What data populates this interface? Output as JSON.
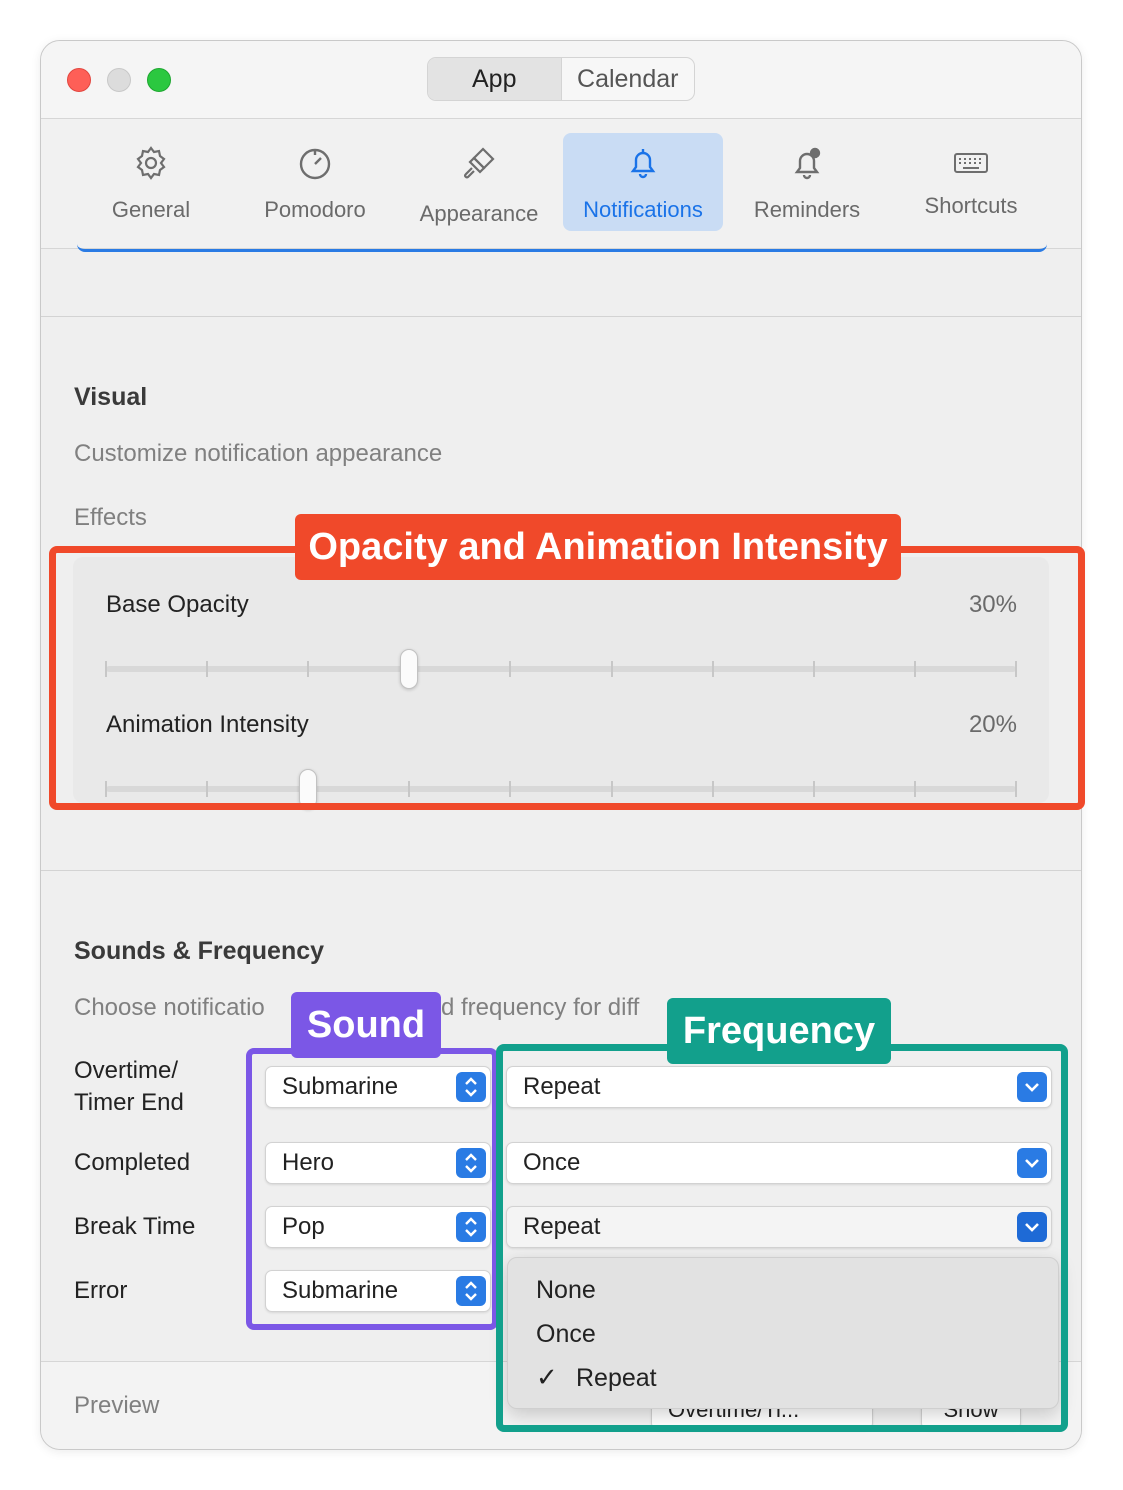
{
  "window": {
    "tabs": [
      {
        "label": "App",
        "active": true
      },
      {
        "label": "Calendar",
        "active": false
      }
    ]
  },
  "toolbar": {
    "items": [
      {
        "label": "General",
        "icon": "gear-icon"
      },
      {
        "label": "Pomodoro",
        "icon": "timer-icon"
      },
      {
        "label": "Appearance",
        "icon": "paintbrush-icon"
      },
      {
        "label": "Notifications",
        "icon": "bell-icon",
        "active": true
      },
      {
        "label": "Reminders",
        "icon": "bell-badge-icon"
      },
      {
        "label": "Shortcuts",
        "icon": "keyboard-icon"
      }
    ]
  },
  "visual": {
    "title": "Visual",
    "subtitle": "Customize notification appearance",
    "effects_label": "Effects",
    "sliders": [
      {
        "label": "Base Opacity",
        "value_text": "30%",
        "value": 0.3
      },
      {
        "label": "Animation Intensity",
        "value_text": "20%",
        "value": 0.2
      }
    ]
  },
  "sounds": {
    "title": "Sounds & Frequency",
    "subtitle_left": "Choose notificatio",
    "subtitle_right": "d frequency for diff",
    "rows": [
      {
        "label": "Overtime/\nTimer End",
        "sound": "Submarine",
        "frequency": "Repeat"
      },
      {
        "label": "Completed",
        "sound": "Hero",
        "frequency": "Once"
      },
      {
        "label": "Break Time",
        "sound": "Pop",
        "frequency": "Repeat"
      },
      {
        "label": "Error",
        "sound": "Submarine"
      }
    ]
  },
  "frequency_menu": {
    "options": [
      {
        "label": "None",
        "checked": false
      },
      {
        "label": "Once",
        "checked": false
      },
      {
        "label": "Repeat",
        "checked": true
      }
    ],
    "check_glyph": "✓"
  },
  "preview": {
    "label": "Preview",
    "partial_popup_text": "Overtime/Ti...",
    "partial_button_text": "Show"
  },
  "annotations": {
    "opacity": "Opacity and Animation Intensity",
    "sound": "Sound",
    "frequency": "Frequency"
  },
  "colors": {
    "accent": "#2a7be4",
    "annotation_orange": "#f0492a",
    "annotation_purple": "#7b57e6",
    "annotation_teal": "#12a08c"
  }
}
